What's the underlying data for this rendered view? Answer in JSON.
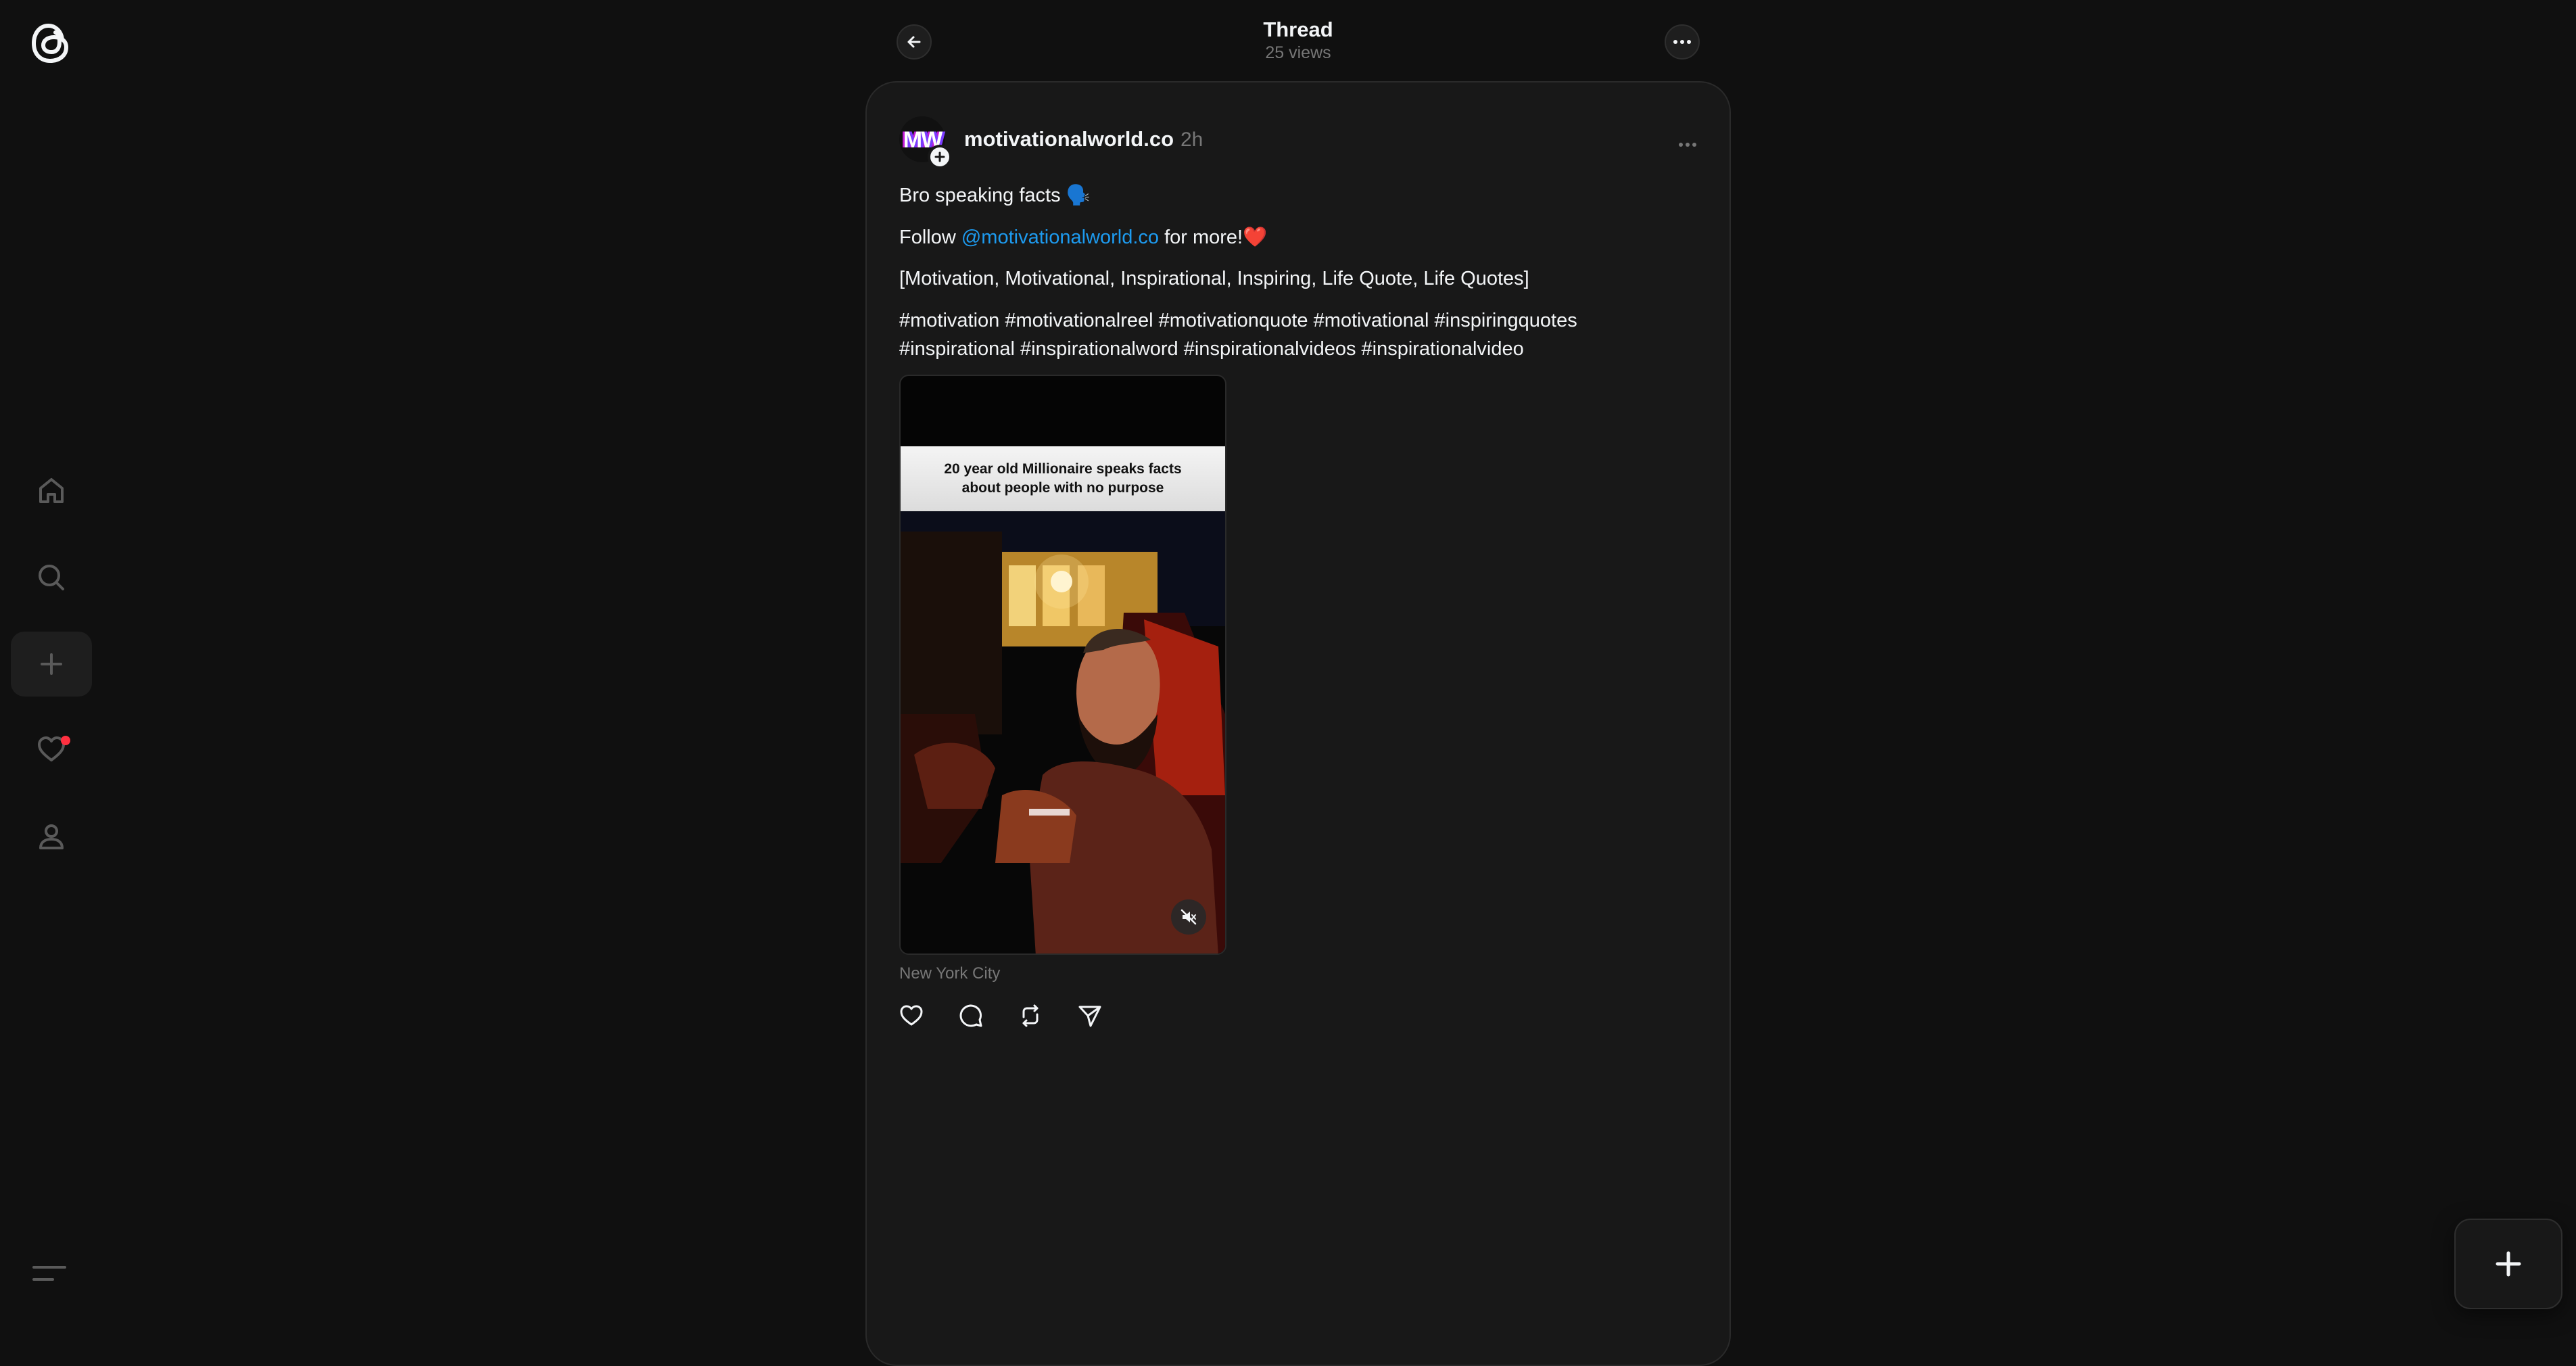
{
  "header": {
    "title": "Thread",
    "views": "25 views"
  },
  "sidebar": {
    "items": [
      {
        "icon": "home-icon"
      },
      {
        "icon": "search-icon"
      },
      {
        "icon": "plus-icon",
        "active": true
      },
      {
        "icon": "heart-icon",
        "has_notification": true
      },
      {
        "icon": "profile-icon"
      }
    ],
    "menu_icon": "menu-icon"
  },
  "post": {
    "avatar_letters": "MW",
    "username": "motivationalworld.co",
    "time": "2h",
    "line1": "Bro speaking facts 🗣️",
    "follow_prefix": "Follow ",
    "mention": "@motivationalworld.co",
    "follow_suffix": " for more!",
    "follow_emoji": "❤️",
    "keywords": "[Motivation, Motivational, Inspirational, Inspiring, Life Quote, Life Quotes]",
    "hashtags_line1": "#motivation #motivationalreel #motivationquote #motivational #inspiringquotes",
    "hashtags_line2": "#inspirational #inspirationalword #inspirationalvideos #inspirationalvideo",
    "media_caption": "20 year old Millionaire speaks facts about people with no purpose",
    "location": "New York City"
  },
  "actions": [
    "like-icon",
    "comment-icon",
    "repost-icon",
    "share-icon"
  ],
  "colors": {
    "background": "#101010",
    "card": "#181818",
    "link": "#1d9bf0",
    "notification": "#ff3040",
    "muted_text": "#777777"
  }
}
